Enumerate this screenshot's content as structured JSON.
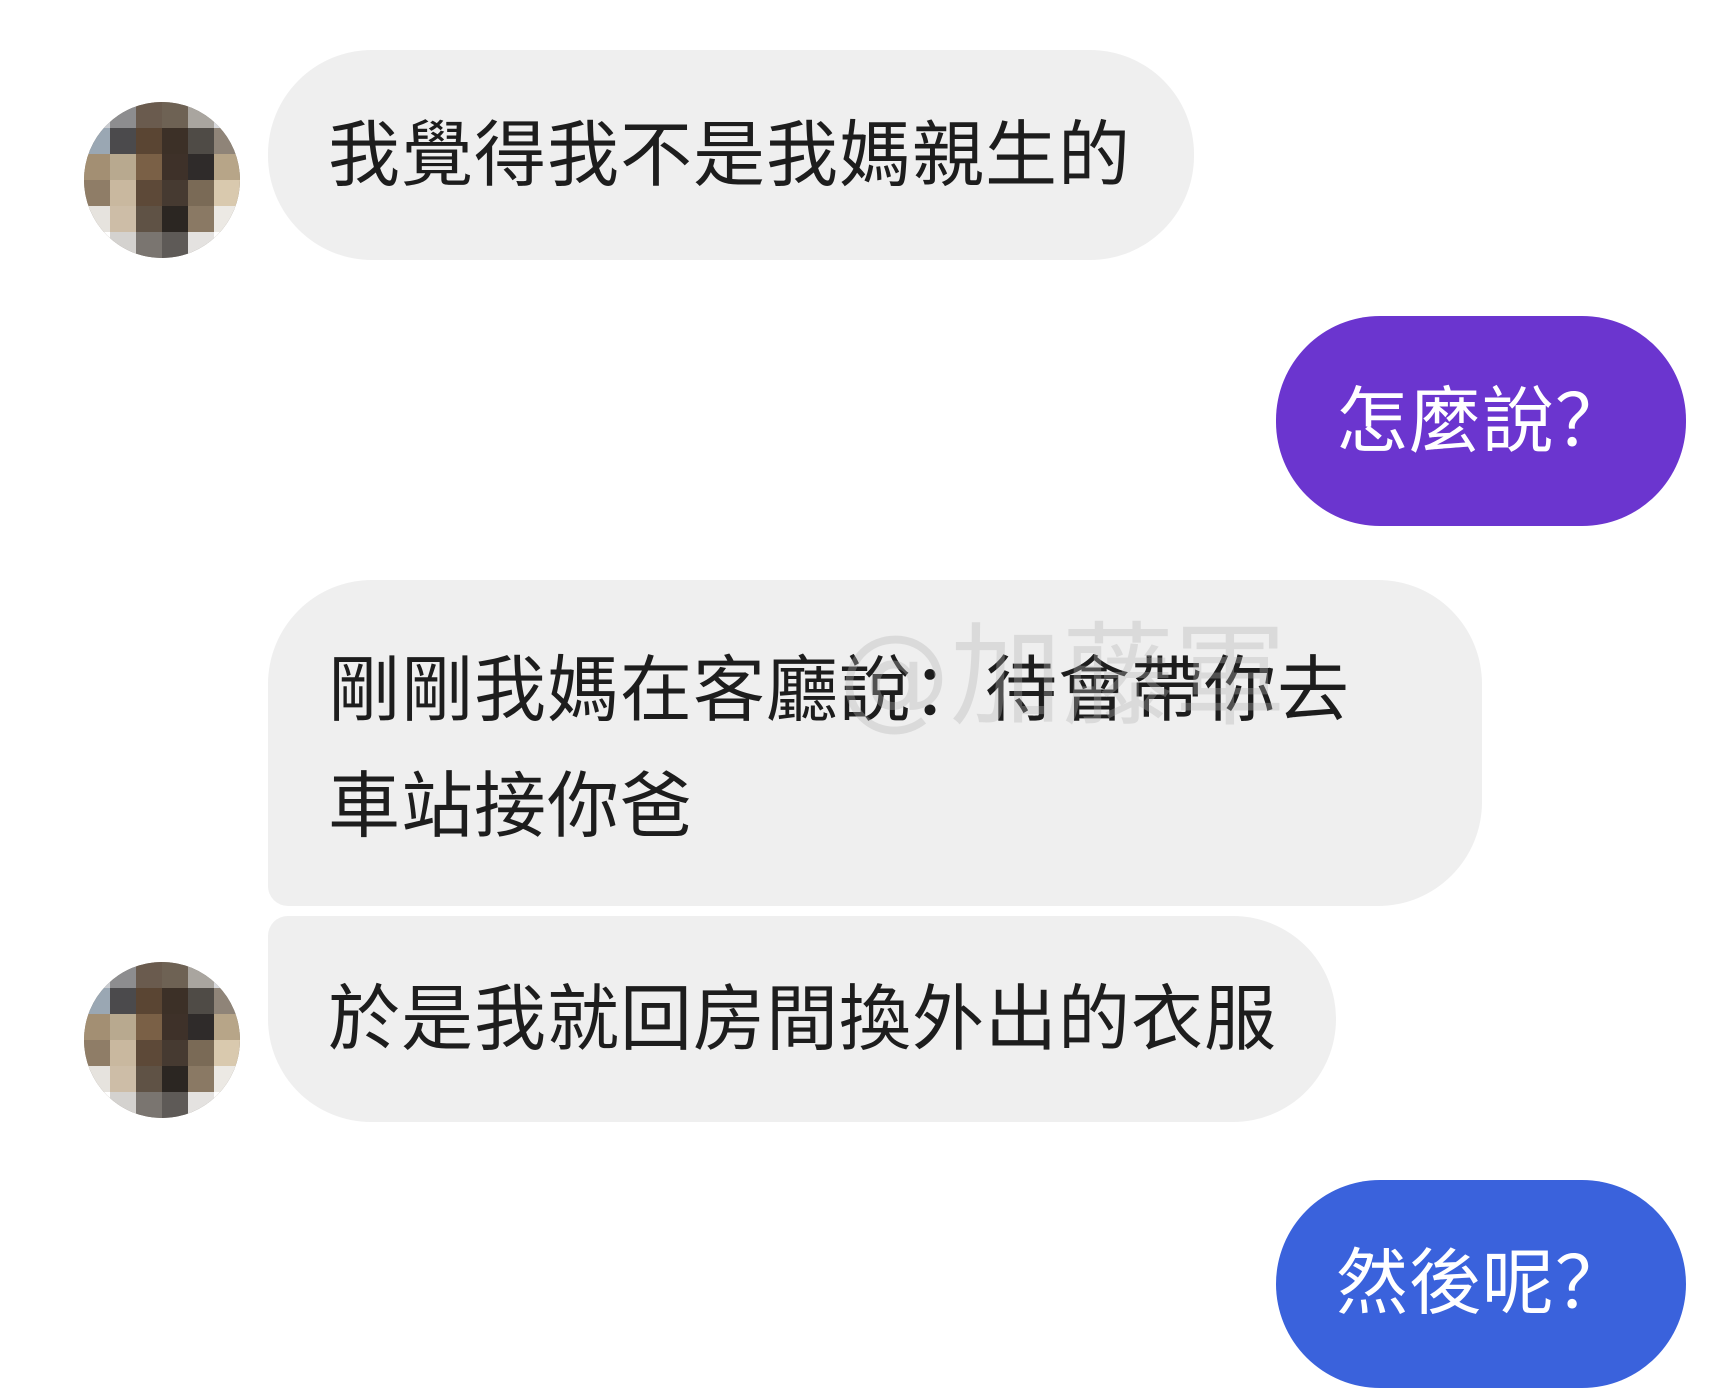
{
  "messages": [
    {
      "text": "我覺得我不是我媽親生的"
    },
    {
      "text": "怎麼說？",
      "color": "#6b35cf"
    },
    {
      "text": "剛剛我媽在客廳說：待會帶你去車站接你爸"
    },
    {
      "text": "於是我就回房間換外出的衣服"
    },
    {
      "text": "然後呢？",
      "color": "#3a62dc"
    }
  ],
  "watermark": "@加藤軍",
  "avatar_icon": "pixelated-user-avatar",
  "colors": {
    "incoming_bubble": "#efefef",
    "outgoing_purple": "#6b35cf",
    "outgoing_blue": "#3a62dc"
  }
}
